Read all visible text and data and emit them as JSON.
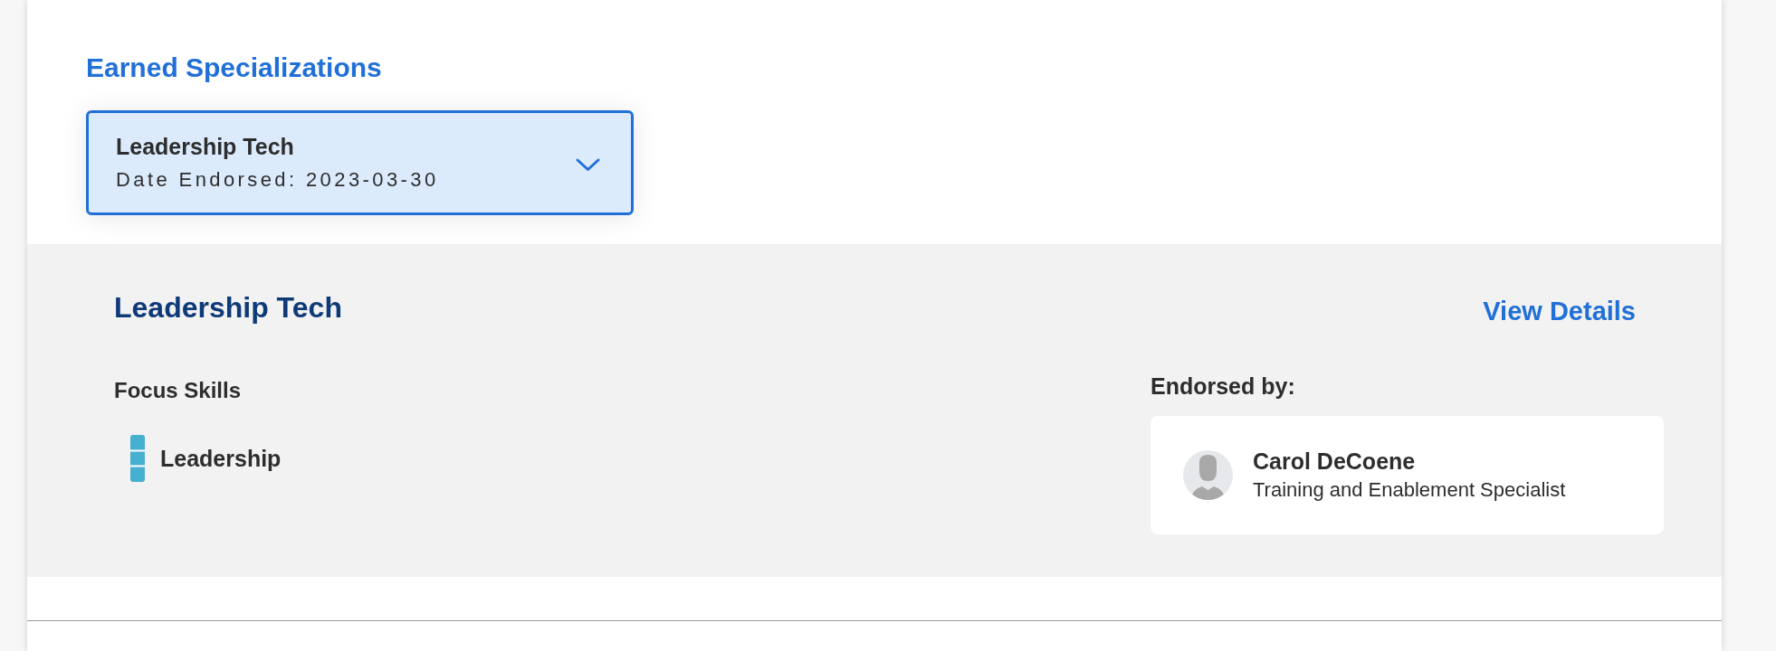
{
  "section": {
    "title": "Earned Specializations"
  },
  "specialization_dropdown": {
    "title": "Leadership Tech",
    "subtitle": "Date Endorsed: 2023-03-30",
    "expanded": false
  },
  "details": {
    "title": "Leadership Tech",
    "link": "View Details",
    "focus_skills": {
      "heading": "Focus Skills",
      "items": [
        {
          "label": "Leadership"
        }
      ]
    },
    "endorsements": {
      "heading": "Endorsed by:",
      "endorsers": [
        {
          "name": "Carol DeCoene",
          "role": "Training and Enablement Specialist"
        }
      ]
    }
  }
}
